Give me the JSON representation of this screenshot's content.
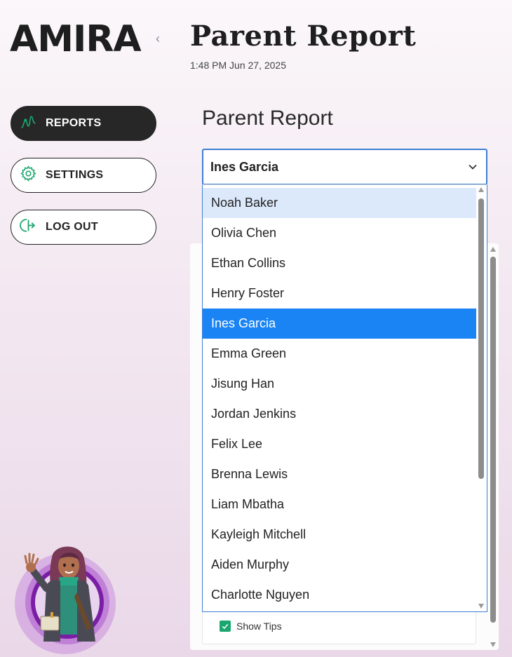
{
  "brand": {
    "logo_text": "AMIRA",
    "collapse_glyph": "‹"
  },
  "header": {
    "title": "Parent Report",
    "timestamp": "1:48 PM Jun 27, 2025"
  },
  "sidebar": {
    "items": [
      {
        "label": "REPORTS",
        "icon": "chart-line-icon",
        "active": true
      },
      {
        "label": "SETTINGS",
        "icon": "gear-icon",
        "active": false
      },
      {
        "label": "LOG OUT",
        "icon": "logout-icon",
        "active": false
      }
    ]
  },
  "main": {
    "section_title": "Parent Report",
    "student_select": {
      "value": "Ines Garcia",
      "options": [
        "Noah Baker",
        "Olivia Chen",
        "Ethan Collins",
        "Henry Foster",
        "Ines Garcia",
        "Emma Green",
        "Jisung Han",
        "Jordan Jenkins",
        "Felix Lee",
        "Brenna Lewis",
        "Liam Mbatha",
        "Kayleigh Mitchell",
        "Aiden Murphy",
        "Charlotte Nguyen"
      ],
      "hovered": "Noah Baker",
      "selected": "Ines Garcia"
    },
    "show_tips": {
      "label": "Show Tips",
      "checked": true
    }
  },
  "colors": {
    "accent": "#1a84f5",
    "focus_border": "#3d7fd3",
    "hover": "#dce9fb",
    "check": "#1aa66e",
    "icon_green": "#1aa66e"
  }
}
